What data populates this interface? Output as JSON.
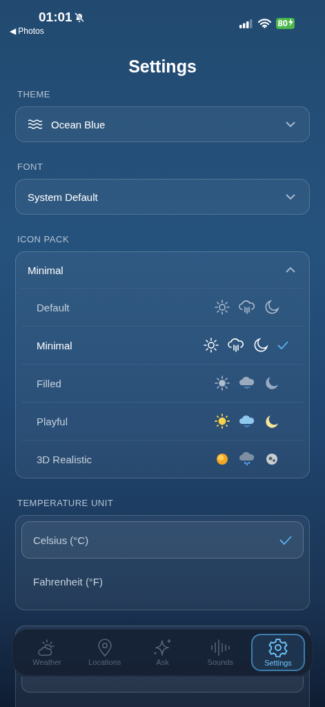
{
  "status_bar": {
    "time": "01:01",
    "silent": true,
    "back": "◀ Photos",
    "battery": "80",
    "charging": true
  },
  "title": "Settings",
  "theme": {
    "label": "THEME",
    "value": "Ocean Blue"
  },
  "font": {
    "label": "FONT",
    "value": "System Default"
  },
  "icon_pack": {
    "label": "ICON PACK",
    "value": "Minimal",
    "expanded": true,
    "options": [
      {
        "label": "Default",
        "kind": "outline",
        "selected": false
      },
      {
        "label": "Minimal",
        "kind": "bright",
        "selected": true
      },
      {
        "label": "Filled",
        "kind": "filled",
        "selected": false
      },
      {
        "label": "Playful",
        "kind": "playful",
        "selected": false
      },
      {
        "label": "3D Realistic",
        "kind": "realistic",
        "selected": false
      }
    ]
  },
  "temperature_unit": {
    "label": "TEMPERATURE UNIT",
    "options": [
      {
        "label": "Celsius (°C)",
        "selected": true
      },
      {
        "label": "Fahrenheit (°F)",
        "selected": false
      }
    ]
  },
  "tab_bar": [
    {
      "label": "Weather",
      "selected": false
    },
    {
      "label": "Locations",
      "selected": false
    },
    {
      "label": "Ask",
      "selected": false
    },
    {
      "label": "Sounds",
      "selected": false
    },
    {
      "label": "Settings",
      "selected": true
    }
  ]
}
